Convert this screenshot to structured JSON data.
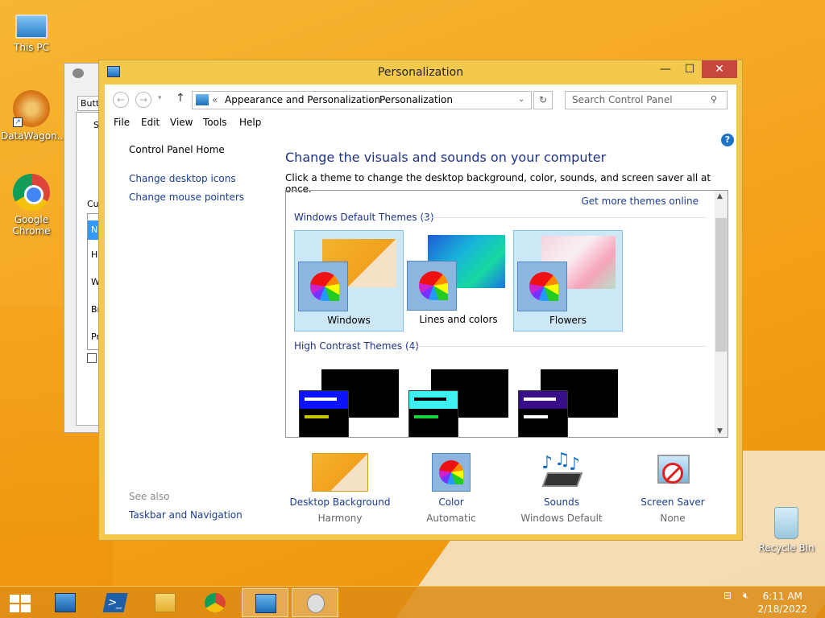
{
  "desktop": {
    "icons": [
      {
        "label": "This PC"
      },
      {
        "label": "DataWagon..."
      },
      {
        "label": "Google Chrome"
      },
      {
        "label": "Recycle Bin"
      }
    ]
  },
  "background_dialog": {
    "tab": "Butto",
    "label_s": "S",
    "label_cus": "Cus",
    "list": [
      "N",
      "H",
      "W",
      "Br",
      "Pr"
    ]
  },
  "window": {
    "title": "Personalization",
    "close_glyph": "✕",
    "max_glyph": "☐",
    "min_glyph": "—"
  },
  "address": {
    "back_glyph": "←",
    "forward_glyph": "→",
    "up_glyph": "↑",
    "sep": "«",
    "crumb1": "Appearance and Personalization",
    "crumb_sep": "›",
    "crumb2": "Personalization",
    "refresh_glyph": "↻",
    "search_placeholder": "Search Control Panel"
  },
  "menu": [
    "File",
    "Edit",
    "View",
    "Tools",
    "Help"
  ],
  "leftnav": {
    "home": "Control Panel Home",
    "icons": "Change desktop icons",
    "pointers": "Change mouse pointers",
    "see_also": "See also",
    "taskbar": "Taskbar and Navigation"
  },
  "main": {
    "heading": "Change the visuals and sounds on your computer",
    "subheading": "Click a theme to change the desktop background, color, sounds, and screen saver all at once.",
    "get_more": "Get more themes online",
    "help": "?"
  },
  "themes": {
    "group1": "Windows Default Themes (3)",
    "group2": "High Contrast Themes (4)",
    "items": [
      {
        "label": "Windows"
      },
      {
        "label": "Lines and colors"
      },
      {
        "label": "Flowers"
      }
    ],
    "hc_colors": [
      {
        "bar": "#0b13ff",
        "accent": "#c8c800"
      },
      {
        "bar": "#3ef0f0",
        "accent": "#17d43a"
      },
      {
        "bar": "#3a0d8a",
        "accent": "#ffffff"
      }
    ]
  },
  "bottom": [
    {
      "title": "Desktop Background",
      "value": "Harmony"
    },
    {
      "title": "Color",
      "value": "Automatic"
    },
    {
      "title": "Sounds",
      "value": "Windows Default"
    },
    {
      "title": "Screen Saver",
      "value": "None"
    }
  ],
  "taskbar": {
    "clock_time": "6:11 AM",
    "clock_date": "2/18/2022"
  }
}
